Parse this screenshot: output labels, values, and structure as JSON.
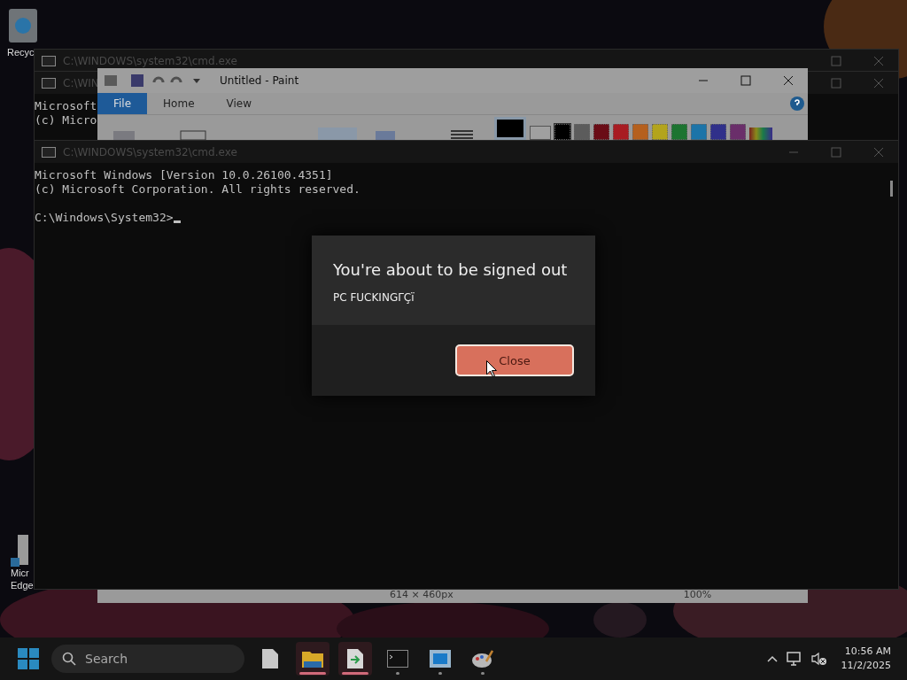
{
  "desktop_icons": [
    {
      "kind": "recycle",
      "lines": [
        "Recyc"
      ]
    },
    {
      "kind": "shortcut",
      "lines": [
        "Micr",
        "Edge"
      ]
    }
  ],
  "back_windows": [
    {
      "title": "C:\\WINDOWS\\system32\\cmd.exe"
    },
    {
      "title": "C:\\WIN",
      "lines": [
        "Microsoft",
        "(c) Micro"
      ]
    }
  ],
  "paint": {
    "title": "Untitled - Paint",
    "tabs": [
      {
        "label": "File",
        "selected": true
      },
      {
        "label": "Home",
        "selected": false
      },
      {
        "label": "View",
        "selected": false
      }
    ],
    "colors": [
      {
        "color": "#000000",
        "selected": true
      },
      {
        "color": "#5c5c5c",
        "selected": false
      },
      {
        "color": "#6a0c16",
        "selected": false
      },
      {
        "color": "#a81c22",
        "selected": false
      },
      {
        "color": "#b5601e",
        "selected": false
      },
      {
        "color": "#b3a41c",
        "selected": false
      },
      {
        "color": "#1c7430",
        "selected": false
      },
      {
        "color": "#1c74a8",
        "selected": false
      },
      {
        "color": "#30308a",
        "selected": false
      },
      {
        "color": "#6a2e6a",
        "selected": false
      }
    ],
    "status": {
      "size": "614 × 460px",
      "zoom": "100%"
    }
  },
  "console": {
    "title": "C:\\WINDOWS\\system32\\cmd.exe",
    "lines": [
      "Microsoft Windows [Version 10.0.26100.4351]",
      "(c) Microsoft Corporation. All rights reserved."
    ],
    "prompt": "C:\\Windows\\System32>"
  },
  "dialog": {
    "title": "You're about to be signed out",
    "message": "PC FUCKINGΓÇï",
    "button": "Close"
  },
  "taskbar": {
    "search": "Search",
    "apps": [
      {
        "kind": "file",
        "running": false,
        "attention": false
      },
      {
        "kind": "folder",
        "running": true,
        "attention": true
      },
      {
        "kind": "script",
        "running": true,
        "attention": true
      },
      {
        "kind": "terminal",
        "running": true,
        "attention": false
      },
      {
        "kind": "window",
        "running": true,
        "attention": false
      },
      {
        "kind": "paint",
        "running": true,
        "attention": false
      }
    ],
    "time": "10:56 AM",
    "date": "11/2/2025"
  }
}
